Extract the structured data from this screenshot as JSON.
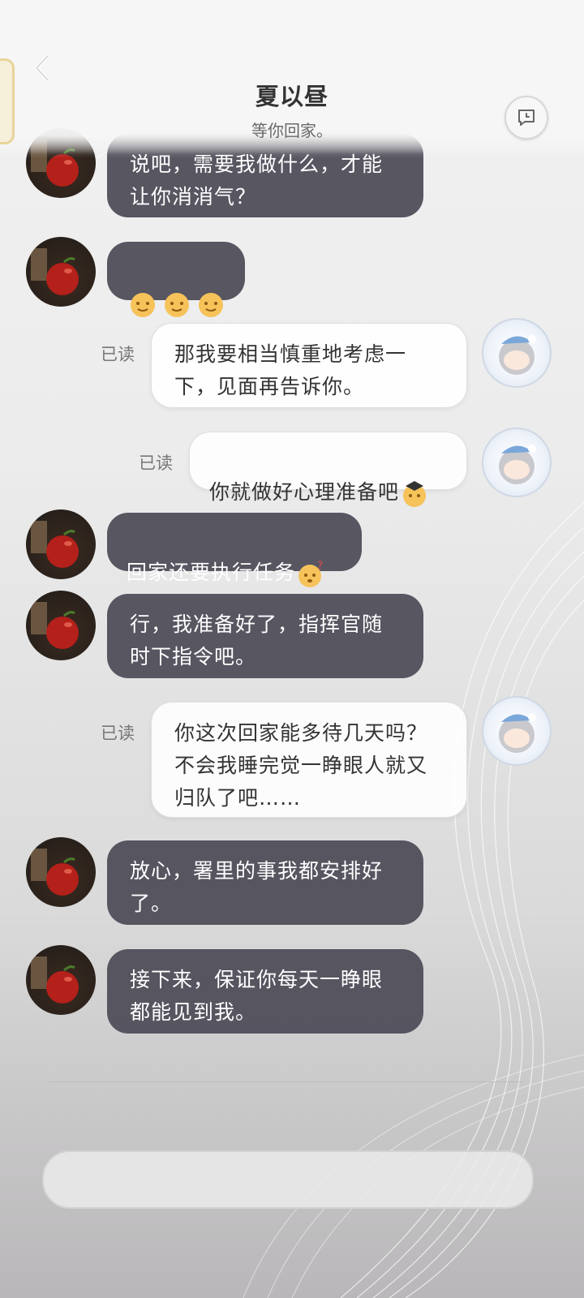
{
  "header": {
    "title": "夏以昼",
    "subtitle": "等你回家。"
  },
  "messages": [
    {
      "side": "in",
      "text": "说吧，需要我做什么，才能\n让你消消气？"
    },
    {
      "side": "in",
      "text": "",
      "emojis": [
        "yellow-smile-emoji",
        "yellow-smile-emoji",
        "yellow-smile-emoji"
      ]
    },
    {
      "side": "out",
      "text": "那我要相当慎重地考虑一\n下，见面再告诉你。",
      "status": "已读"
    },
    {
      "side": "out",
      "text": "你就做好心理准备吧",
      "status": "已读",
      "emoji": "graduate-cap-emoji"
    },
    {
      "side": "in",
      "text": "回家还要执行任务",
      "emoji": "question-emoji"
    },
    {
      "side": "in",
      "text": "行，我准备好了，指挥官随\n时下指令吧。"
    },
    {
      "side": "out",
      "text": "你这次回家能多待几天吗？\n不会我睡完觉一睁眼人就又\n归队了吧……",
      "status": "已读"
    },
    {
      "side": "in",
      "text": "放心，署里的事我都安排好\n了。"
    },
    {
      "side": "in",
      "text": "接下来，保证你每天一睁眼\n都能见到我。"
    }
  ],
  "input": {
    "placeholder": ""
  },
  "colors": {
    "incoming_bubble": "#4e4c58",
    "outgoing_bubble": "#ffffff",
    "accent_gold": "#e8d49a"
  }
}
